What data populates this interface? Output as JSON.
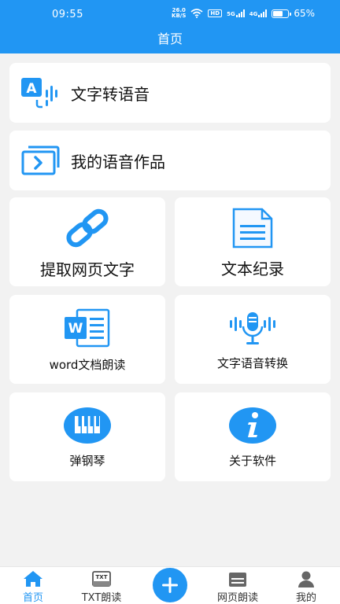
{
  "status_bar": {
    "time": "09:55",
    "net_speed_top": "26.0",
    "net_speed_bottom": "KB/S",
    "hd_label": "HD",
    "signal1_label": "5G",
    "signal2_label": "4G",
    "battery_percent": "65%",
    "battery_level": 0.65
  },
  "header": {
    "title": "首页"
  },
  "main": {
    "text_to_speech_label": "文字转语音",
    "my_works_label": "我的语音作品",
    "tiles": {
      "extract_web_text": "提取网页文字",
      "text_records": "文本纪录",
      "word_read": "word文档朗读",
      "text_voice_convert": "文字语音转换",
      "piano": "弹钢琴",
      "about": "关于软件"
    }
  },
  "tab_bar": {
    "home": "首页",
    "txt_read": "TXT朗读",
    "web_read": "网页朗读",
    "mine": "我的",
    "txt_badge": "TXT"
  },
  "colors": {
    "accent": "#2196f3",
    "background": "#f2f2f2",
    "card": "#ffffff"
  },
  "icons": {
    "text_to_speech": "translate-voice-icon",
    "my_works": "voice-works-icon",
    "extract_web_text": "link-chain-icon",
    "text_records": "document-icon",
    "word_read": "word-document-icon",
    "text_voice_convert": "microphone-icon",
    "piano": "piano-icon",
    "about": "info-icon",
    "add": "plus-icon"
  }
}
